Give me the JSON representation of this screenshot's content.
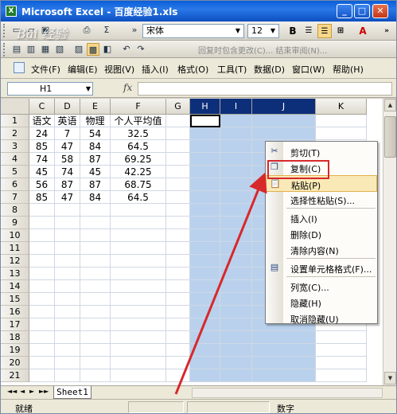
{
  "window": {
    "title": "Microsoft Excel - 百度经验1.xls",
    "minimize": "_",
    "maximize": "□",
    "close": "✕"
  },
  "toolbar": {
    "font_name": "宋体",
    "font_size": "12",
    "bold": "B",
    "font_color": "A",
    "review_text": "回复时包含更改(C)... 结束审阅(N)..."
  },
  "menubar": {
    "items": [
      "文件(F)",
      "编辑(E)",
      "视图(V)",
      "插入(I)",
      "格式(O)",
      "工具(T)",
      "数据(D)",
      "窗口(W)",
      "帮助(H)"
    ]
  },
  "formula_bar": {
    "name_box": "H1",
    "fx": "fx"
  },
  "grid": {
    "columns": [
      "C",
      "D",
      "E",
      "F",
      "G",
      "H",
      "I",
      "J",
      "K"
    ],
    "selected_columns": [
      "H",
      "I",
      "J"
    ],
    "row_numbers": [
      "1",
      "2",
      "3",
      "4",
      "5",
      "6",
      "7",
      "8",
      "9",
      "10",
      "11",
      "12",
      "13",
      "14",
      "15",
      "16",
      "17",
      "18",
      "19",
      "20",
      "21"
    ],
    "rows": [
      [
        "语文",
        "英语",
        "物理",
        "个人平均值"
      ],
      [
        "24",
        "7",
        "54",
        "32.5"
      ],
      [
        "85",
        "47",
        "84",
        "64.5"
      ],
      [
        "74",
        "58",
        "87",
        "69.25"
      ],
      [
        "45",
        "74",
        "45",
        "42.25"
      ],
      [
        "56",
        "87",
        "87",
        "68.75"
      ],
      [
        "85",
        "47",
        "84",
        "64.5"
      ]
    ]
  },
  "sheet_tabs": {
    "nav": [
      "◄◄",
      "◄",
      "►",
      "►►"
    ],
    "active": "Sheet1"
  },
  "status": {
    "left": "就绪",
    "right": "数字"
  },
  "context_menu": {
    "items": [
      {
        "label": "剪切(T)",
        "icon": "scissors-icon",
        "glyph": "✂"
      },
      {
        "label": "复制(C)",
        "icon": "copy-icon",
        "glyph": "❐"
      },
      {
        "label": "粘贴(P)",
        "icon": "paste-icon",
        "glyph": "📋"
      },
      {
        "label": "选择性粘贴(S)...",
        "icon": "",
        "glyph": ""
      },
      {
        "label": "插入(I)",
        "icon": "",
        "glyph": ""
      },
      {
        "label": "删除(D)",
        "icon": "",
        "glyph": ""
      },
      {
        "label": "清除内容(N)",
        "icon": "",
        "glyph": ""
      },
      {
        "label": "设置单元格格式(F)...",
        "icon": "format-cells-icon",
        "glyph": "▤"
      },
      {
        "label": "列宽(C)...",
        "icon": "",
        "glyph": ""
      },
      {
        "label": "隐藏(H)",
        "icon": "",
        "glyph": ""
      },
      {
        "label": "取消隐藏(U)",
        "icon": "",
        "glyph": ""
      }
    ],
    "highlighted_index": 2
  },
  "colors": {
    "selection": "#b9d1ec",
    "header_selected": "#0d2f7a",
    "annotation_red": "#d7282b",
    "menu_highlight": "#f9e9b6"
  }
}
